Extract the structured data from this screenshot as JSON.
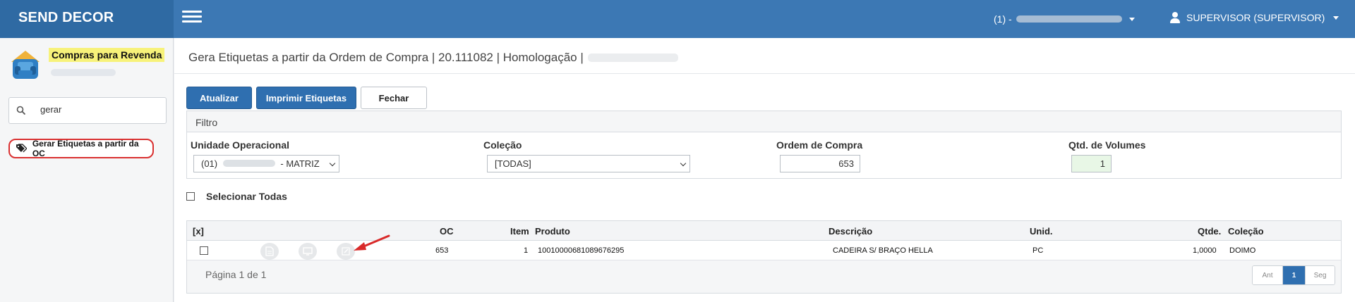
{
  "header": {
    "brand": "SEND DECOR",
    "company_prefix": "(1) -",
    "user_label": "SUPERVISOR (SUPERVISOR)"
  },
  "sidebar": {
    "module_title": "Compras para Revenda",
    "search": {
      "value": "gerar"
    },
    "active_item": "Gerar Etiquetas a partir da OC"
  },
  "main": {
    "page_title": "Gera Etiquetas a partir da Ordem de Compra | 20.111082 | Homologação |",
    "buttons": {
      "update": "Atualizar",
      "print": "Imprimir Etiquetas",
      "close": "Fechar"
    },
    "filter": {
      "title": "Filtro",
      "unit_label": "Unidade Operacional",
      "unit_prefix": "(01)",
      "unit_suffix": "- MATRIZ",
      "collection_label": "Coleção",
      "collection_value": "[TODAS]",
      "po_label": "Ordem de Compra",
      "po_value": "653",
      "volumes_label": "Qtd. de Volumes",
      "volumes_value": "1"
    },
    "select_all": "Selecionar Todas",
    "grid": {
      "headers": {
        "check": "[x]",
        "oc": "OC",
        "item": "Item",
        "product": "Produto",
        "description": "Descrição",
        "unit": "Unid.",
        "qty": "Qtde.",
        "collection": "Coleção"
      },
      "rows": [
        {
          "oc": "653",
          "item": "1",
          "product": "10010000681089676295",
          "description": "CADEIRA S/ BRAÇO HELLA",
          "unit": "PC",
          "qty": "1,0000",
          "collection": "DOIMO"
        }
      ],
      "pagination_text": "Página 1 de 1",
      "pager": {
        "prev": "Ant",
        "current": "1",
        "next": "Seg"
      }
    }
  },
  "colors": {
    "header_bg": "#3c78b4",
    "brand_bg": "#2f6aa3",
    "primary_button": "#2f6fb0",
    "highlight": "#f7f27a",
    "annotation_red": "#d93030"
  },
  "icons": [
    "menu-icon",
    "user-icon",
    "module-sofa-icon",
    "search-icon",
    "tag-icon",
    "document-icon",
    "monitor-icon",
    "edit-icon",
    "arrow-annotation"
  ]
}
